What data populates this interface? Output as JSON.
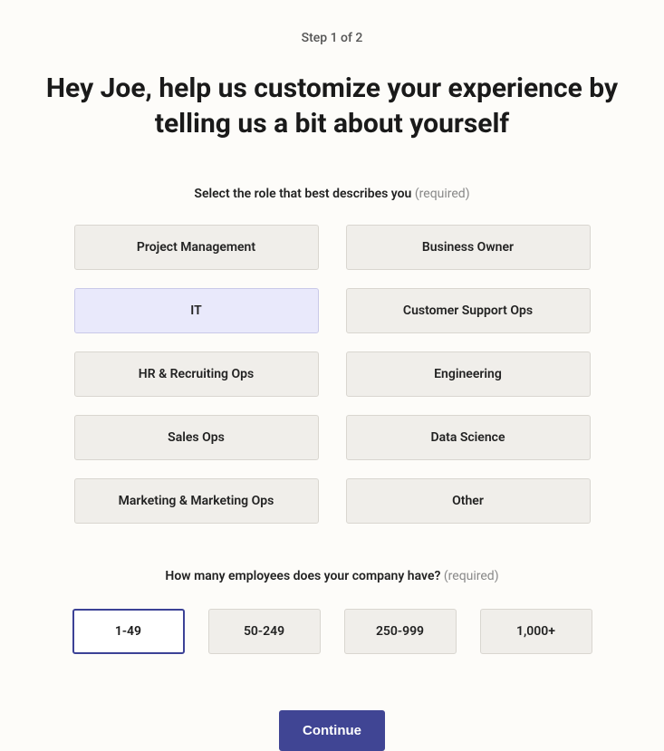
{
  "step_label": "Step 1 of 2",
  "title": "Hey Joe, help us customize your experience by telling us a bit about yourself",
  "role_section": {
    "label": "Select the role that best describes you",
    "required": "(required)",
    "options": [
      {
        "label": "Project Management",
        "selected": false
      },
      {
        "label": "Business Owner",
        "selected": false
      },
      {
        "label": "IT",
        "selected": true
      },
      {
        "label": "Customer Support Ops",
        "selected": false
      },
      {
        "label": "HR & Recruiting Ops",
        "selected": false
      },
      {
        "label": "Engineering",
        "selected": false
      },
      {
        "label": "Sales Ops",
        "selected": false
      },
      {
        "label": "Data Science",
        "selected": false
      },
      {
        "label": "Marketing & Marketing Ops",
        "selected": false
      },
      {
        "label": "Other",
        "selected": false
      }
    ]
  },
  "employee_section": {
    "label": "How many employees does your company have?",
    "required": "(required)",
    "options": [
      {
        "label": "1-49",
        "selected": true
      },
      {
        "label": "50-249",
        "selected": false
      },
      {
        "label": "250-999",
        "selected": false
      },
      {
        "label": "1,000+",
        "selected": false
      }
    ]
  },
  "continue_label": "Continue"
}
